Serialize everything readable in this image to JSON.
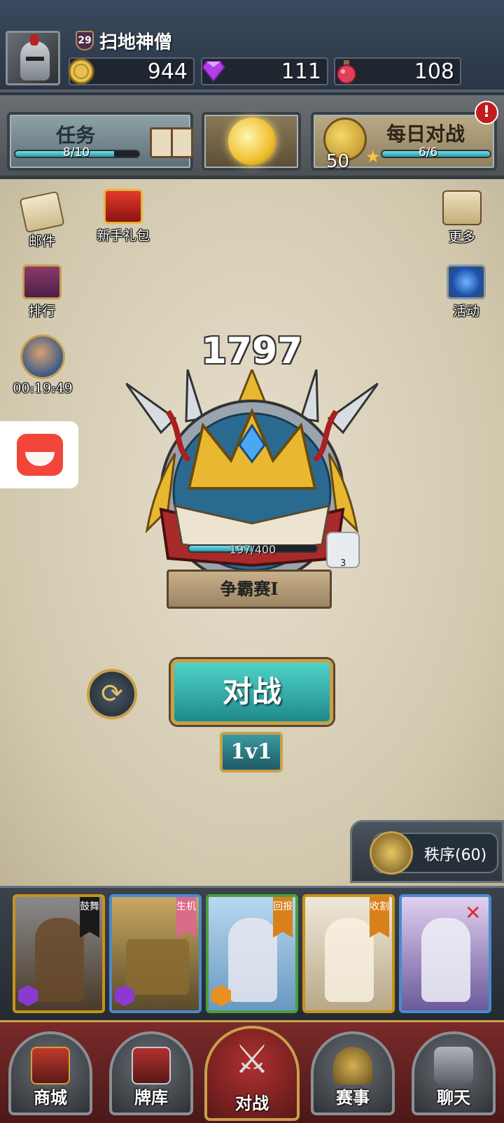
{
  "player": {
    "level": "29",
    "name": "扫地神僧"
  },
  "resources": {
    "gold": "944",
    "gems": "111",
    "potion": "108"
  },
  "task": {
    "label": "任务",
    "progress_text": "8/10",
    "progress": 0.8
  },
  "daily_battle": {
    "label": "每日对战",
    "coins": "50",
    "progress_text": "6/6",
    "progress": 1.0,
    "alert": "!"
  },
  "side_left": {
    "mail": "邮件",
    "newbie_gift": "新手礼包",
    "rank": "排行",
    "timer": "00:19:49"
  },
  "side_right": {
    "more": "更多",
    "activity": "活动"
  },
  "rank": {
    "score": "1797",
    "progress_text": "197/400",
    "progress": 0.4925,
    "tier": "争霸赛Ⅰ",
    "badge_count": "3"
  },
  "battle": {
    "button": "对战",
    "mode": "1v1",
    "refresh_icon": "refresh-icon"
  },
  "order": {
    "label": "秩序(60)"
  },
  "cards": [
    {
      "tag": "鼓舞",
      "tag_color": "#1a1a1a",
      "cost_color": "#8a3ad0"
    },
    {
      "tag": "生机",
      "tag_color": "#d86a8a",
      "cost_color": "#8a3ad0"
    },
    {
      "tag": "回报",
      "tag_color": "#d8801a",
      "cost_color": "#e89020"
    },
    {
      "tag": "收割",
      "tag_color": "#d8801a",
      "cost_color": ""
    },
    {
      "tag": "",
      "tag_color": "",
      "cost_color": ""
    }
  ],
  "nav": {
    "shop": "商城",
    "deck": "牌库",
    "battle": "对战",
    "tournament": "赛事",
    "chat": "聊天"
  },
  "colors": {
    "accent_teal": "#2fb0b0",
    "gold": "#c8a04a"
  }
}
